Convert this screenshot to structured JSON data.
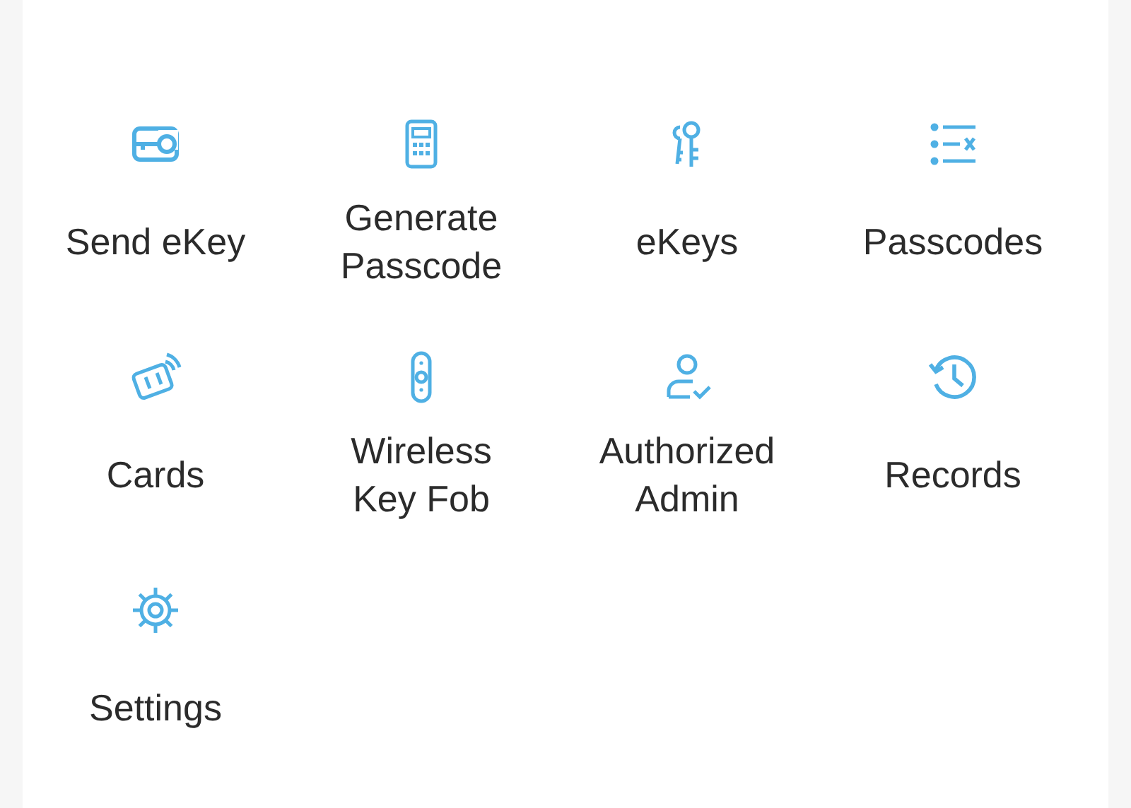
{
  "items": [
    {
      "label": "Send eKey",
      "kind": "sendkey"
    },
    {
      "label": "Generate Passcode",
      "kind": "generate"
    },
    {
      "label": "eKeys",
      "kind": "ekeys"
    },
    {
      "label": "Passcodes",
      "kind": "passcodes"
    },
    {
      "label": "Cards",
      "kind": "cards"
    },
    {
      "label": "Wireless Key Fob",
      "kind": "fob"
    },
    {
      "label": "Authorized Admin",
      "kind": "admin"
    },
    {
      "label": "Records",
      "kind": "records"
    },
    {
      "label": "Settings",
      "kind": "settings"
    }
  ]
}
